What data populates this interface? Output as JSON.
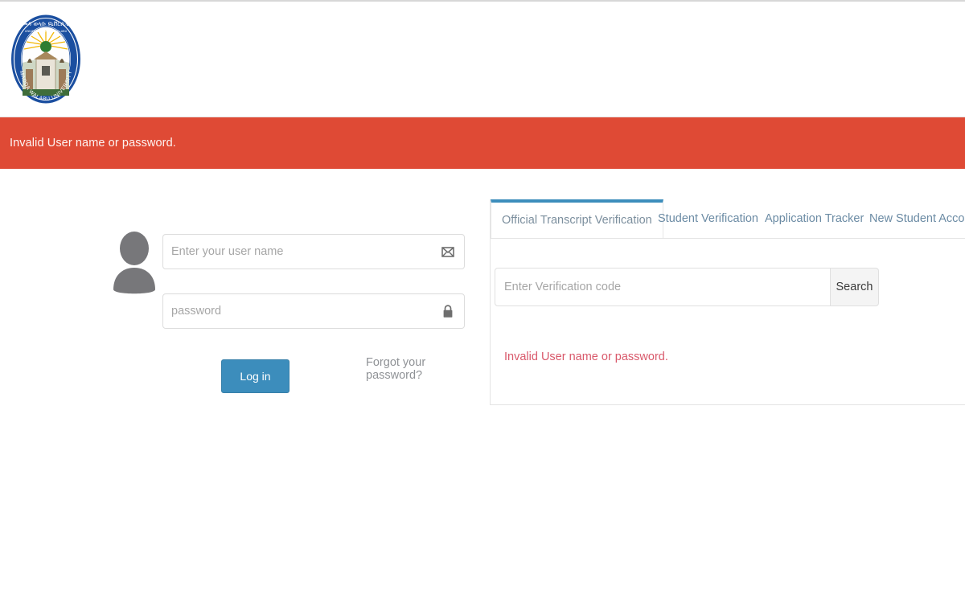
{
  "header": {
    "logo": {
      "icon": "university-seal-logo",
      "amharic_top": "መዳ ወላቡ ዩኒቨርሲቲ",
      "amharic_sub": "UNIVERSITY MADDA WALABU",
      "name_bottom": "MADDA WALABU UNIVERSITY"
    }
  },
  "alert": {
    "icon": "alert-banner",
    "message": "Invalid User name or password.",
    "background": "#df4a35",
    "text_color": "#fdf3f1"
  },
  "login": {
    "avatar_icon": "user-avatar-icon",
    "username": {
      "value": "",
      "placeholder": "Enter your user name",
      "icon": "envelope-icon"
    },
    "password": {
      "value": "",
      "placeholder": "password",
      "icon": "lock-icon"
    },
    "login_button": "Log in",
    "forgot_link": "Forgot your password?",
    "button_color": "#3c8dbc"
  },
  "verification": {
    "tabs": [
      {
        "label": "Official Transcript Verification",
        "active": true
      },
      {
        "label": "Student Verification",
        "active": false
      },
      {
        "label": "Application Tracker",
        "active": false
      },
      {
        "label": "New Student Account",
        "active": false
      }
    ],
    "active_tab_color": "#3c8dbc",
    "code_input": {
      "value": "",
      "placeholder": "Enter Verification code"
    },
    "search_button": "Search",
    "error_message": "Invalid User name or password.",
    "error_color": "#d9596b"
  }
}
